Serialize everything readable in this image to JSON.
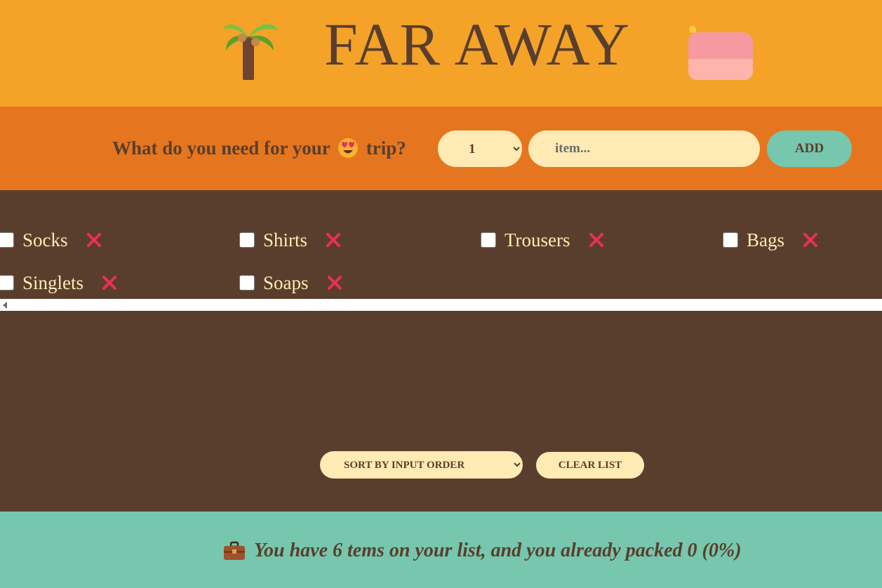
{
  "header": {
    "title": "FAR  AWAY",
    "left_icon": "palm-tree-icon",
    "right_icon": "pouch-icon"
  },
  "form": {
    "question_before": "What do you need for your",
    "question_emoji": "smiling-face-with-heart-eyes-icon",
    "question_after": "trip?",
    "quantity_selected": "1",
    "item_placeholder": "item...",
    "add_label": "ADD"
  },
  "items": [
    {
      "label": "Socks",
      "packed": false
    },
    {
      "label": "Shirts",
      "packed": false
    },
    {
      "label": "Trousers",
      "packed": false
    },
    {
      "label": "Bags",
      "packed": false
    },
    {
      "label": "Singlets",
      "packed": false
    },
    {
      "label": "Soaps",
      "packed": false
    }
  ],
  "actions": {
    "sort_selected": "SORT BY INPUT ORDER",
    "clear_label": "CLEAR LIST"
  },
  "stats": {
    "icon": "briefcase-icon",
    "text": "You have 6 tems on your list, and you already packed 0 (0%)"
  },
  "colors": {
    "header": "#f4a328",
    "form": "#e5761f",
    "list": "#5a3e2d",
    "stats": "#76c7ad",
    "cream": "#ffebb3",
    "delete": "#e8305a"
  }
}
